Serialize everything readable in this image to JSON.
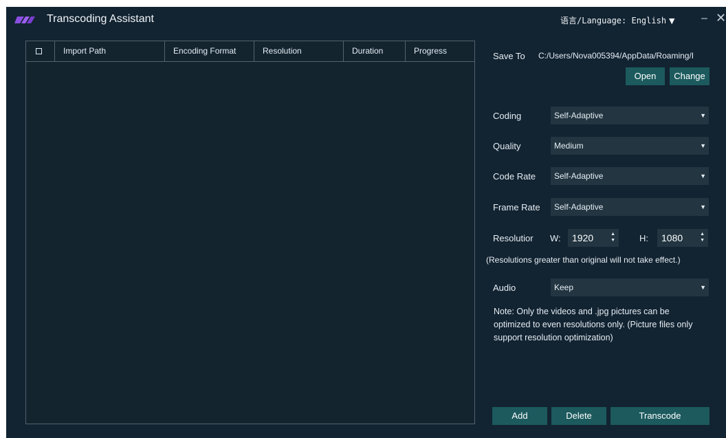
{
  "title_bar": {
    "app_title": "Transcoding Assistant",
    "language_label": "语言/Language: English",
    "minimize_glyph": "–",
    "close_glyph": "✕"
  },
  "file_table": {
    "columns": [
      "Import Path",
      "Encoding Format",
      "Resolution",
      "Duration",
      "Progress"
    ],
    "rows": []
  },
  "settings": {
    "save_to_label": "Save To",
    "save_path": "C:/Users/Nova005394/AppData/Roaming/I",
    "open_button": "Open",
    "change_button": "Change",
    "coding_label": "Coding",
    "coding_value": "Self-Adaptive",
    "quality_label": "Quality",
    "quality_value": "Medium",
    "code_rate_label": "Code Rate",
    "code_rate_value": "Self-Adaptive",
    "frame_rate_label": "Frame Rate",
    "frame_rate_value": "Self-Adaptive",
    "resolution_label": "Resolutior",
    "width_label": "W:",
    "width_value": "1920",
    "height_label": "H:",
    "height_value": "1080",
    "resolution_hint": "(Resolutions greater than original will not take effect.)",
    "audio_label": "Audio",
    "audio_value": "Keep",
    "note": "Note: Only the videos and .jpg pictures can be optimized to even resolutions only. (Picture files only support resolution optimization)"
  },
  "actions": {
    "add": "Add",
    "delete": "Delete",
    "transcode": "Transcode"
  },
  "colors": {
    "background": "#122331",
    "button": "#1c5a5e",
    "select": "#223541",
    "logo": "#8a4fe0"
  }
}
